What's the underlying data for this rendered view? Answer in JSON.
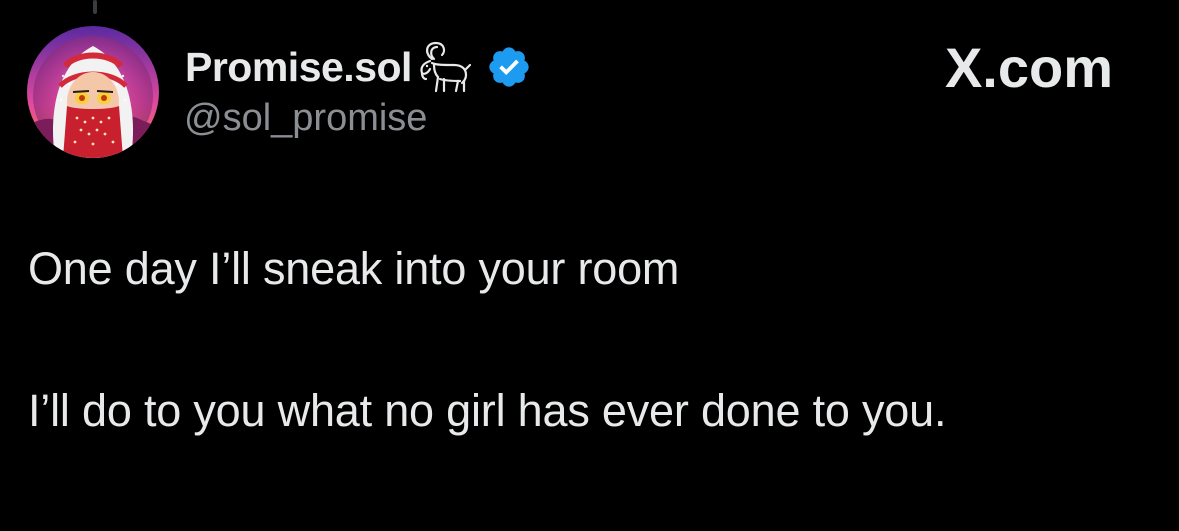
{
  "post": {
    "author": {
      "display_name": "Promise.sol",
      "name_emoji": "goat-icon",
      "verified_badge": "verified-icon",
      "handle": "@sol_promise"
    },
    "brand": "X.com",
    "lines": [
      "One day I’ll sneak into your room",
      "I’ll do to you what no girl has ever done to you."
    ]
  },
  "colors": {
    "background": "#000000",
    "primary_text": "#e7e9ea",
    "secondary_text": "#8b8f94",
    "verified_blue": "#1d9bf0"
  }
}
